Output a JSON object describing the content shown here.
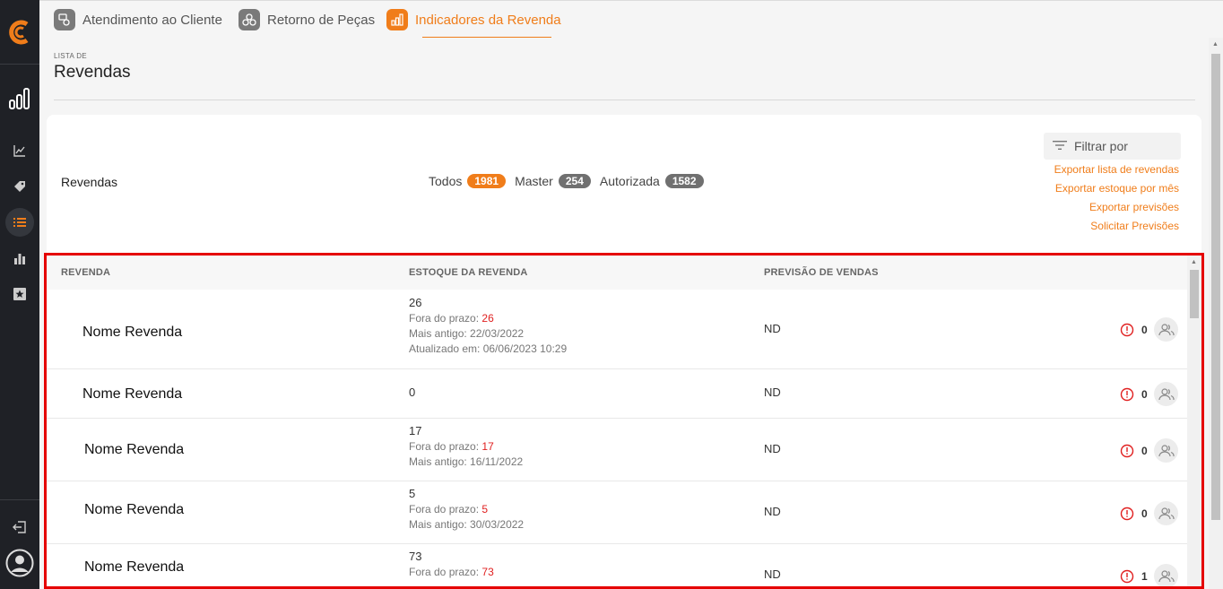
{
  "tabs": [
    {
      "label": "Atendimento ao Cliente"
    },
    {
      "label": "Retorno de Peças"
    },
    {
      "label": "Indicadores da Revenda"
    }
  ],
  "header": {
    "kicker": "LISTA DE",
    "title": "Revendas"
  },
  "toolbar": {
    "section_label": "Revendas",
    "filters": [
      {
        "label": "Todos",
        "count": "1981"
      },
      {
        "label": "Master",
        "count": "254"
      },
      {
        "label": "Autorizada",
        "count": "1582"
      }
    ],
    "filter_by": "Filtrar por",
    "links": [
      "Exportar lista de revendas",
      "Exportar estoque por mês",
      "Exportar previsões",
      "Solicitar Previsões"
    ]
  },
  "table": {
    "columns": [
      "REVENDA",
      "ESTOQUE DA REVENDA",
      "PREVISÃO DE VENDAS"
    ],
    "rows": [
      {
        "name": "Nome Revenda",
        "stock": "26",
        "late_label": "Fora do prazo:",
        "late": "26",
        "oldest": "Mais antigo: 22/03/2022",
        "updated": "Atualizado em: 06/06/2023 10:29",
        "forecast": "ND",
        "alerts": "0"
      },
      {
        "name": "Nome Revenda",
        "stock": "0",
        "forecast": "ND",
        "alerts": "0"
      },
      {
        "name": "Nome Revenda",
        "stock": "17",
        "late_label": "Fora do prazo:",
        "late": "17",
        "oldest": "Mais antigo: 16/11/2022",
        "forecast": "ND",
        "alerts": "0"
      },
      {
        "name": "Nome Revenda",
        "stock": "5",
        "late_label": "Fora do prazo:",
        "late": "5",
        "oldest": "Mais antigo: 30/03/2022",
        "forecast": "ND",
        "alerts": "0"
      },
      {
        "name": "Nome Revenda",
        "stock": "73",
        "late_label": "Fora do prazo:",
        "late": "73",
        "forecast": "ND",
        "alerts": "1"
      }
    ]
  },
  "colors": {
    "accent": "#f07d1a",
    "alert": "#e02020",
    "sidebar": "#1f2126",
    "highlight_border": "#e50000"
  },
  "icons": {
    "sidebar": [
      "logo-icon",
      "bar-chart-icon",
      "line-chart-icon",
      "tag-icon",
      "list-icon",
      "stats-icon",
      "star-icon",
      "logout-icon",
      "user-avatar-icon"
    ],
    "row_actions": [
      "alert-circle-icon",
      "users-icon"
    ]
  }
}
